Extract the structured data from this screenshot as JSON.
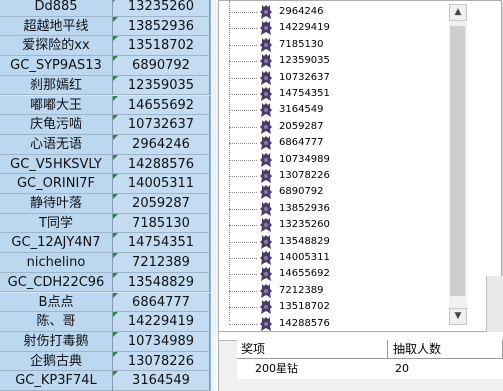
{
  "sheet": {
    "rows": [
      {
        "name": "Dd885",
        "num": "13235260"
      },
      {
        "name": "超越地平线",
        "num": "13852936"
      },
      {
        "name": "爱探险的xx",
        "num": "13518702"
      },
      {
        "name": "GC_SYP9AS13",
        "num": "6890792"
      },
      {
        "name": "刹那嫣红",
        "num": "12359035"
      },
      {
        "name": "嘟嘟大王",
        "num": "14655692"
      },
      {
        "name": "庆龟污啮",
        "num": "10732637"
      },
      {
        "name": "心语无语",
        "num": "2964246"
      },
      {
        "name": "GC_V5HKSVLY",
        "num": "14288576"
      },
      {
        "name": "GC_ORINI7F",
        "num": "14005311"
      },
      {
        "name": "静待叶落",
        "num": "2059287"
      },
      {
        "name": "T同学",
        "num": "7185130"
      },
      {
        "name": "GC_12AJY4N7",
        "num": "14754351"
      },
      {
        "name": "nichelino",
        "num": "7212389"
      },
      {
        "name": "GC_CDH22C96",
        "num": "13548829"
      },
      {
        "name": "B点点",
        "num": "6864777"
      },
      {
        "name": "陈、哥",
        "num": "14229419"
      },
      {
        "name": "射伤打毒鹅",
        "num": "10734989"
      },
      {
        "name": "企鹅古典",
        "num": "13078226"
      },
      {
        "name": "GC_KP3F74L",
        "num": "3164549"
      }
    ]
  },
  "popup": {
    "items": [
      "2964246",
      "14229419",
      "7185130",
      "12359035",
      "10732637",
      "14754351",
      "3164549",
      "2059287",
      "6864777",
      "10734989",
      "13078226",
      "6890792",
      "13852936",
      "13235260",
      "13548829",
      "14005311",
      "14655692",
      "7212389",
      "13518702",
      "14288576"
    ],
    "scroll_up": "▲",
    "scroll_down": "▼"
  },
  "table": {
    "header_prize": "奖项",
    "header_count": "抽取人数",
    "row_prize": "200星钻",
    "row_count": "20"
  }
}
